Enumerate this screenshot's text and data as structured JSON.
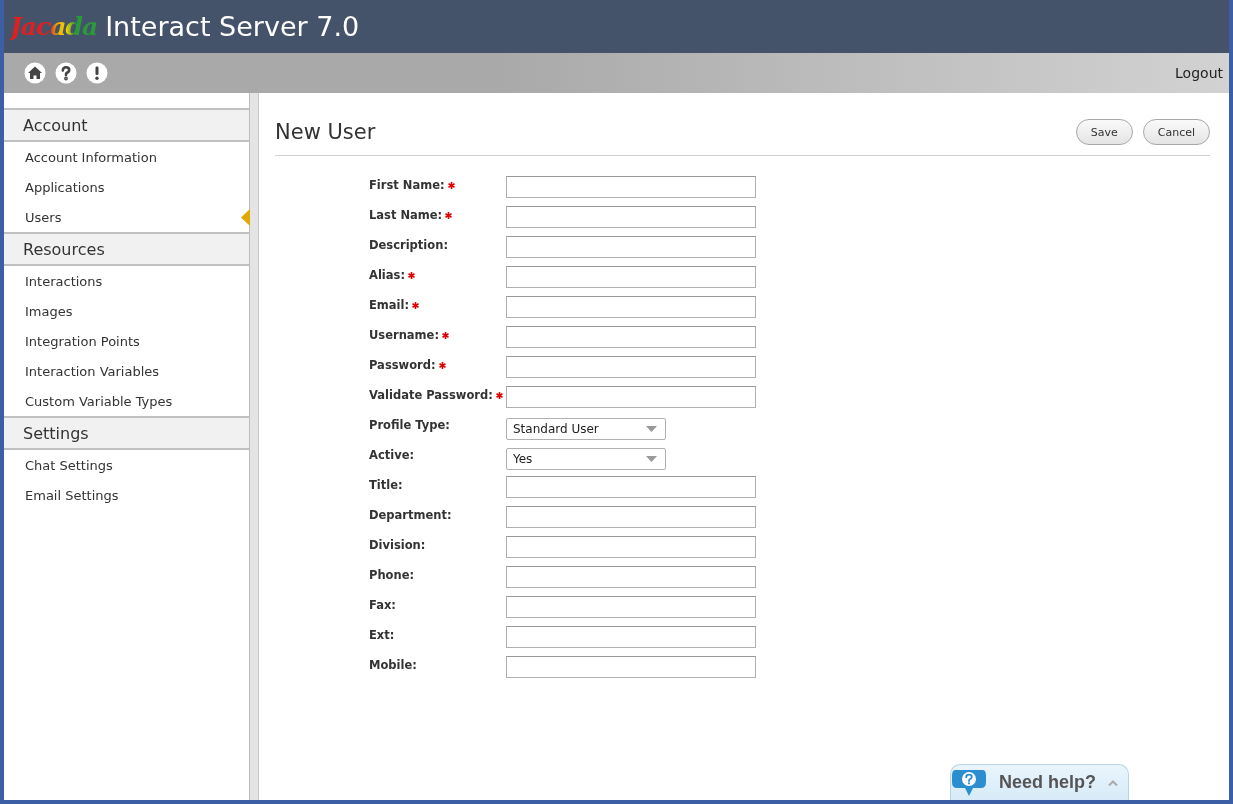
{
  "app": {
    "logo": "Jacada",
    "title": "Interact Server 7.0"
  },
  "toolbar": {
    "logout": "Logout"
  },
  "sidebar": {
    "sections": [
      {
        "title": "Account",
        "items": [
          {
            "label": "Account Information",
            "selected": false
          },
          {
            "label": "Applications",
            "selected": false
          },
          {
            "label": "Users",
            "selected": true
          }
        ]
      },
      {
        "title": "Resources",
        "items": [
          {
            "label": "Interactions",
            "selected": false
          },
          {
            "label": "Images",
            "selected": false
          },
          {
            "label": "Integration Points",
            "selected": false
          },
          {
            "label": "Interaction Variables",
            "selected": false
          },
          {
            "label": "Custom Variable Types",
            "selected": false
          }
        ]
      },
      {
        "title": "Settings",
        "items": [
          {
            "label": "Chat Settings",
            "selected": false
          },
          {
            "label": "Email Settings",
            "selected": false
          }
        ]
      }
    ]
  },
  "page": {
    "title": "New User",
    "buttons": [
      "Save",
      "Cancel"
    ]
  },
  "form": {
    "fields": [
      {
        "label": "First Name:",
        "required": true,
        "kind": "text"
      },
      {
        "label": "Last Name:",
        "required": true,
        "kind": "text"
      },
      {
        "label": "Description:",
        "required": false,
        "kind": "text"
      },
      {
        "label": "Alias:",
        "required": true,
        "kind": "text"
      },
      {
        "label": "Email:",
        "required": true,
        "kind": "text"
      },
      {
        "label": "Username:",
        "required": true,
        "kind": "text"
      },
      {
        "label": "Password:",
        "required": true,
        "kind": "text"
      },
      {
        "label": "Validate Password:",
        "required": true,
        "kind": "text"
      },
      {
        "label": "Profile Type:",
        "required": false,
        "kind": "select",
        "value": "Standard User"
      },
      {
        "label": "Active:",
        "required": false,
        "kind": "select",
        "value": "Yes"
      },
      {
        "label": "Title:",
        "required": false,
        "kind": "text"
      },
      {
        "label": "Department:",
        "required": false,
        "kind": "text"
      },
      {
        "label": "Division:",
        "required": false,
        "kind": "text"
      },
      {
        "label": "Phone:",
        "required": false,
        "kind": "text"
      },
      {
        "label": "Fax:",
        "required": false,
        "kind": "text"
      },
      {
        "label": "Ext:",
        "required": false,
        "kind": "text"
      },
      {
        "label": "Mobile:",
        "required": false,
        "kind": "text"
      }
    ]
  },
  "help": {
    "label": "Need help?"
  }
}
